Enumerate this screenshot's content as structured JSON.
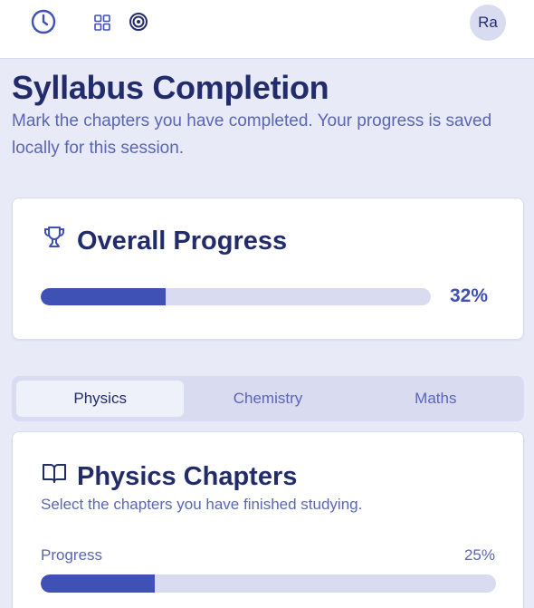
{
  "topbar": {
    "icons": [
      "clock-icon",
      "grid-icon",
      "target-icon"
    ],
    "avatar_initials": "Ra"
  },
  "page": {
    "title": "Syllabus Completion",
    "subtitle": "Mark the chapters you have completed. Your progress is saved locally for this session."
  },
  "overall": {
    "heading": "Overall Progress",
    "icon": "trophy-icon",
    "percent_label": "32%",
    "percent_value": 32
  },
  "tabs": [
    {
      "label": "Physics",
      "active": true
    },
    {
      "label": "Chemistry",
      "active": false
    },
    {
      "label": "Maths",
      "active": false
    }
  ],
  "physics": {
    "heading": "Physics Chapters",
    "icon": "book-icon",
    "description": "Select the chapters you have finished studying.",
    "progress_label": "Progress",
    "percent_label": "25%",
    "percent_value": 25
  },
  "colors": {
    "accent": "#3f51b5",
    "background": "#e8eaf8",
    "text_dark": "#232c6b",
    "text_muted": "#5a66b4",
    "track": "#d9dcf0"
  }
}
